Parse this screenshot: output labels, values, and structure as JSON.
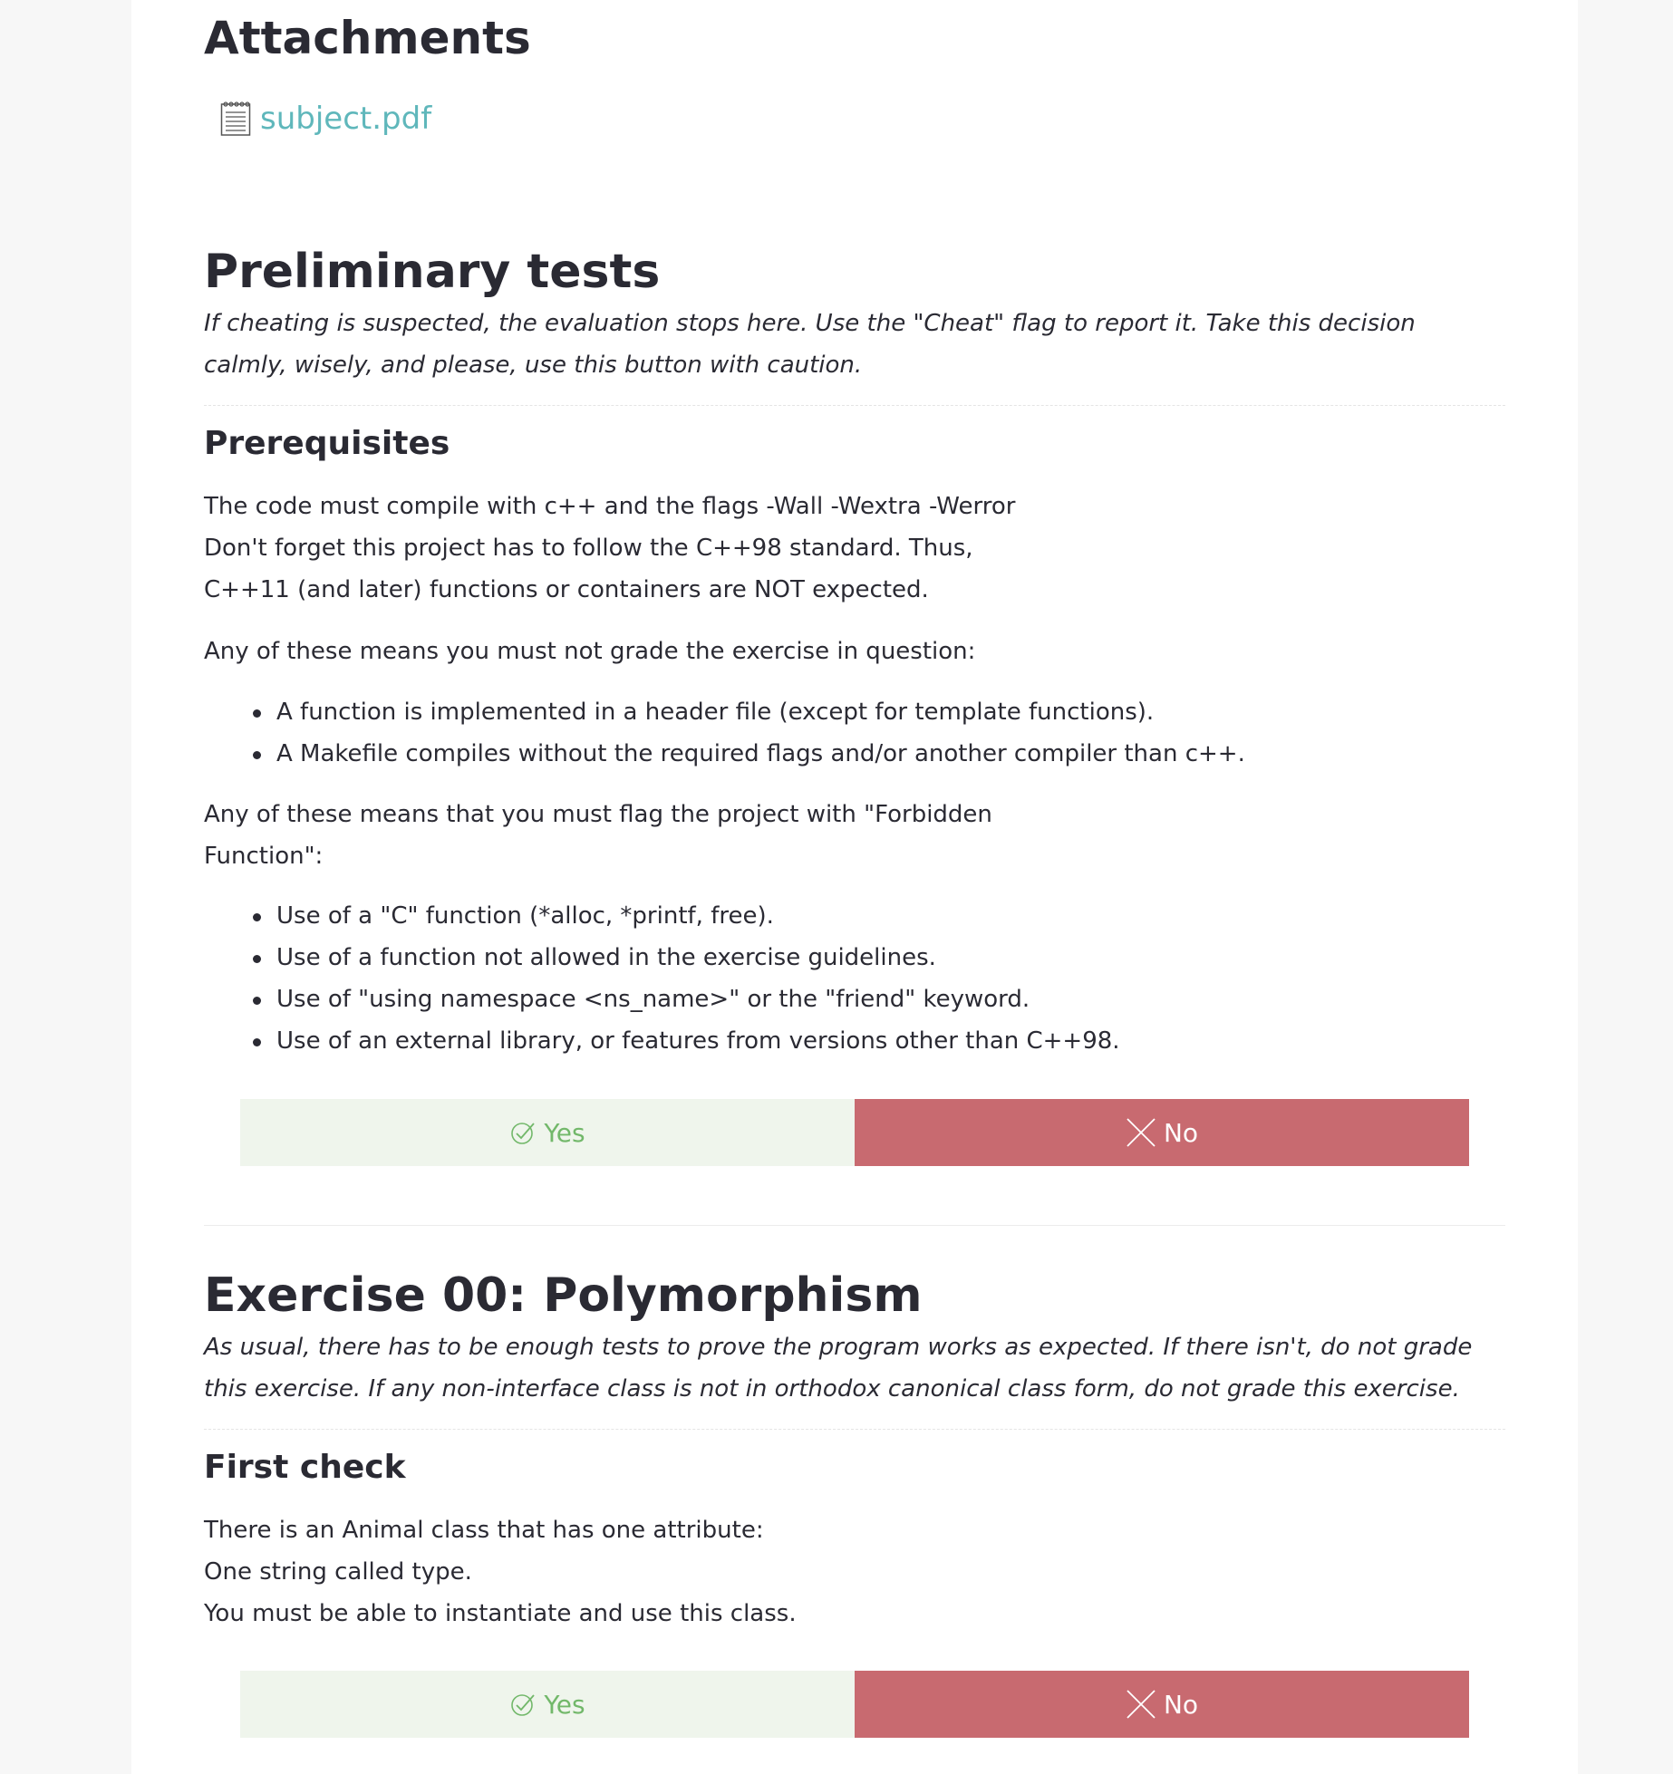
{
  "attachments": {
    "title": "Attachments",
    "file_name": "subject.pdf"
  },
  "preliminary": {
    "title": "Preliminary tests",
    "description": "If cheating is suspected, the evaluation stops here. Use the \"Cheat\" flag to report it. Take this decision calmly, wisely, and please, use this button with caution.",
    "prerequisites": {
      "title": "Prerequisites",
      "lines": [
        "The code must compile with c++ and the flags -Wall -Wextra -Werror",
        "Don't forget this project has to follow the C++98 standard. Thus,",
        "C++11 (and later) functions or containers are NOT expected."
      ],
      "grade_intro": "Any of these means you must not grade the exercise in question:",
      "grade_bullets": [
        "A function is implemented in a header file (except for template functions).",
        "A Makefile compiles without the required flags and/or another compiler than c++."
      ],
      "flag_intro_lines": [
        "Any of these means that you must flag the project with \"Forbidden",
        "Function\":"
      ],
      "flag_bullets": [
        "Use of a \"C\" function (*alloc, *printf, free).",
        "Use of a function not allowed in the exercise guidelines.",
        "Use of \"using namespace <ns_name>\" or the \"friend\" keyword.",
        "Use of an external library, or features from versions other than C++98."
      ],
      "yes_label": "Yes",
      "no_label": "No"
    }
  },
  "exercise00": {
    "title": "Exercise 00: Polymorphism",
    "description": "As usual, there has to be enough tests to prove the program works as expected. If there isn't, do not grade this exercise. If any non-interface class is not in orthodox canonical class form, do not grade this exercise.",
    "first_check": {
      "title": "First check",
      "lines": [
        "There is an Animal class that has one attribute:",
        "One string called type.",
        "You must be able to instantiate and use this class."
      ],
      "yes_label": "Yes",
      "no_label": "No"
    }
  },
  "colors": {
    "link": "#5fb7bb",
    "yes_bg": "#eff5ec",
    "yes_text": "#72b86a",
    "no_bg": "#c86a70",
    "no_text": "#ffffff"
  }
}
